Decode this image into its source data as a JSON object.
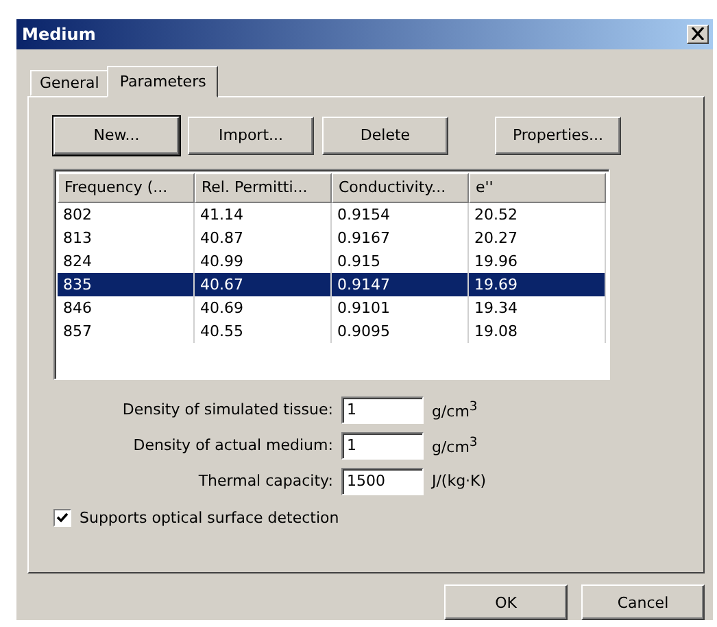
{
  "window": {
    "title": "Medium"
  },
  "tabs": [
    {
      "label": "General",
      "selected": false
    },
    {
      "label": "Parameters",
      "selected": true
    }
  ],
  "toolbar_buttons": [
    "New...",
    "Import...",
    "Delete",
    "Properties..."
  ],
  "table": {
    "columns": [
      "Frequency (...",
      "Rel. Permitti...",
      "Conductivity...",
      "e''"
    ],
    "rows": [
      {
        "cells": [
          "802",
          "41.14",
          "0.9154",
          "20.52"
        ],
        "selected": false
      },
      {
        "cells": [
          "813",
          "40.87",
          "0.9167",
          "20.27"
        ],
        "selected": false
      },
      {
        "cells": [
          "824",
          "40.99",
          "0.915",
          "19.96"
        ],
        "selected": false
      },
      {
        "cells": [
          "835",
          "40.67",
          "0.9147",
          "19.69"
        ],
        "selected": true
      },
      {
        "cells": [
          "846",
          "40.69",
          "0.9101",
          "19.34"
        ],
        "selected": false
      },
      {
        "cells": [
          "857",
          "40.55",
          "0.9095",
          "19.08"
        ],
        "selected": false
      }
    ]
  },
  "fields": [
    {
      "label": "Density of simulated tissue:",
      "value": "1",
      "unit": "g/cm$^{3}$"
    },
    {
      "label": "Density of actual medium:",
      "value": "1",
      "unit": "g/cm$^{3}$"
    },
    {
      "label": "Thermal capacity:",
      "value": "1500",
      "unit": "J/(kg·K)"
    }
  ],
  "checkbox": {
    "label": "Supports optical surface detection",
    "checked": true
  },
  "buttons": [
    "OK",
    "Cancel"
  ]
}
